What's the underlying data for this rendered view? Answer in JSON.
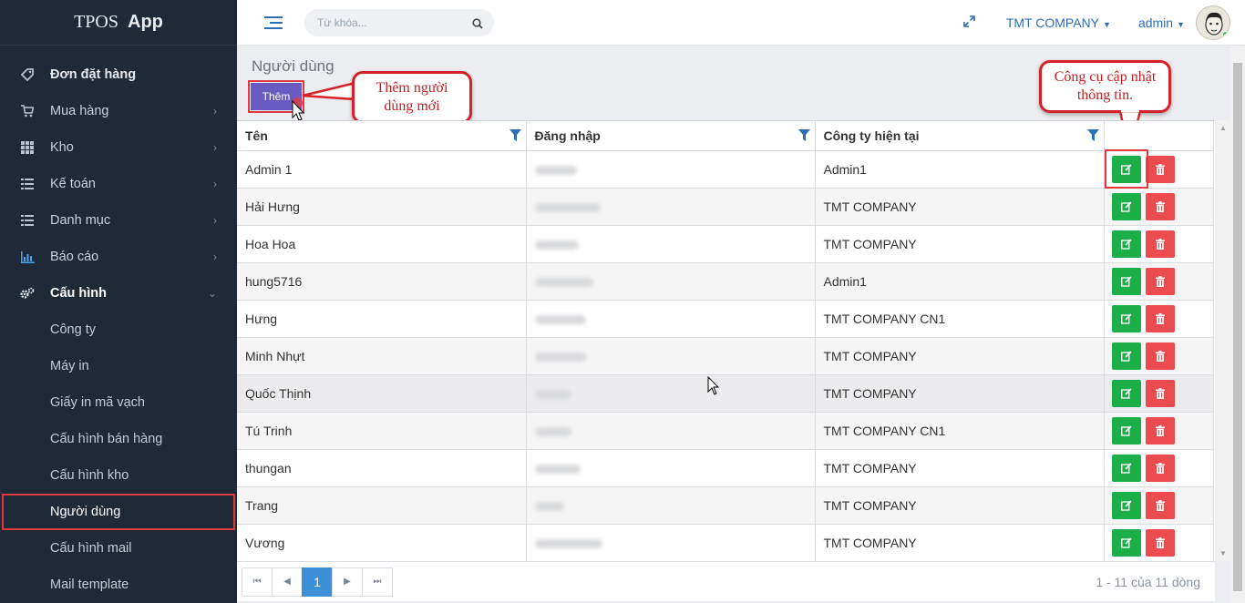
{
  "brand": {
    "part1": "TPOS",
    "part2": "App"
  },
  "sidebar": {
    "items": [
      {
        "label": "Đơn đặt hàng",
        "icon": "tag-icon",
        "has_chevron": false
      },
      {
        "label": "Mua hàng",
        "icon": "cart-icon",
        "has_chevron": true
      },
      {
        "label": "Kho",
        "icon": "grid-icon",
        "has_chevron": true
      },
      {
        "label": "Kế toán",
        "icon": "list-icon",
        "has_chevron": true
      },
      {
        "label": "Danh mục",
        "icon": "list-icon",
        "has_chevron": true
      },
      {
        "label": "Báo cáo",
        "icon": "bar-chart-icon",
        "has_chevron": true
      },
      {
        "label": "Cấu hình",
        "icon": "gears-icon",
        "has_chevron": true
      }
    ],
    "subitems": [
      "Công ty",
      "Máy in",
      "Giấy in mã vạch",
      "Cấu hình bán hàng",
      "Cấu hình kho",
      "Người dùng",
      "Cấu hình mail",
      "Mail template"
    ],
    "active_subitem": "Người dùng"
  },
  "topbar": {
    "search_placeholder": "Từ khóa...",
    "company": "TMT COMPANY",
    "user": "admin"
  },
  "page": {
    "title": "Người dùng",
    "add_label": "Thêm"
  },
  "callouts": {
    "add": "Thêm người dùng mới",
    "edit": "Công cụ cập nhật thông tin."
  },
  "table": {
    "columns": [
      "Tên",
      "Đăng nhập",
      "Công ty hiện tại"
    ],
    "rows": [
      {
        "name": "Admin 1",
        "company": "Admin1"
      },
      {
        "name": "Hải Hưng",
        "company": "TMT COMPANY"
      },
      {
        "name": "Hoa Hoa",
        "company": "TMT COMPANY"
      },
      {
        "name": "hung5716",
        "company": "Admin1"
      },
      {
        "name": "Hưng",
        "company": "TMT COMPANY CN1"
      },
      {
        "name": "Minh Nhựt",
        "company": "TMT COMPANY"
      },
      {
        "name": "Quốc Thịnh",
        "company": "TMT COMPANY"
      },
      {
        "name": "Tú Trinh",
        "company": "TMT COMPANY CN1"
      },
      {
        "name": "thungan",
        "company": "TMT COMPANY"
      },
      {
        "name": "Trang",
        "company": "TMT COMPANY"
      },
      {
        "name": "Vương",
        "company": "TMT COMPANY"
      }
    ]
  },
  "pager": {
    "current_page": "1",
    "info": "1 - 11 của 11 dòng"
  },
  "colors": {
    "sidebar_bg": "#1f2a38",
    "accent_blue": "#2d6fb7",
    "add_button": "#6a5bc2",
    "edit_button": "#1cae48",
    "delete_button": "#ec4b4f",
    "highlight": "#e0393e"
  }
}
